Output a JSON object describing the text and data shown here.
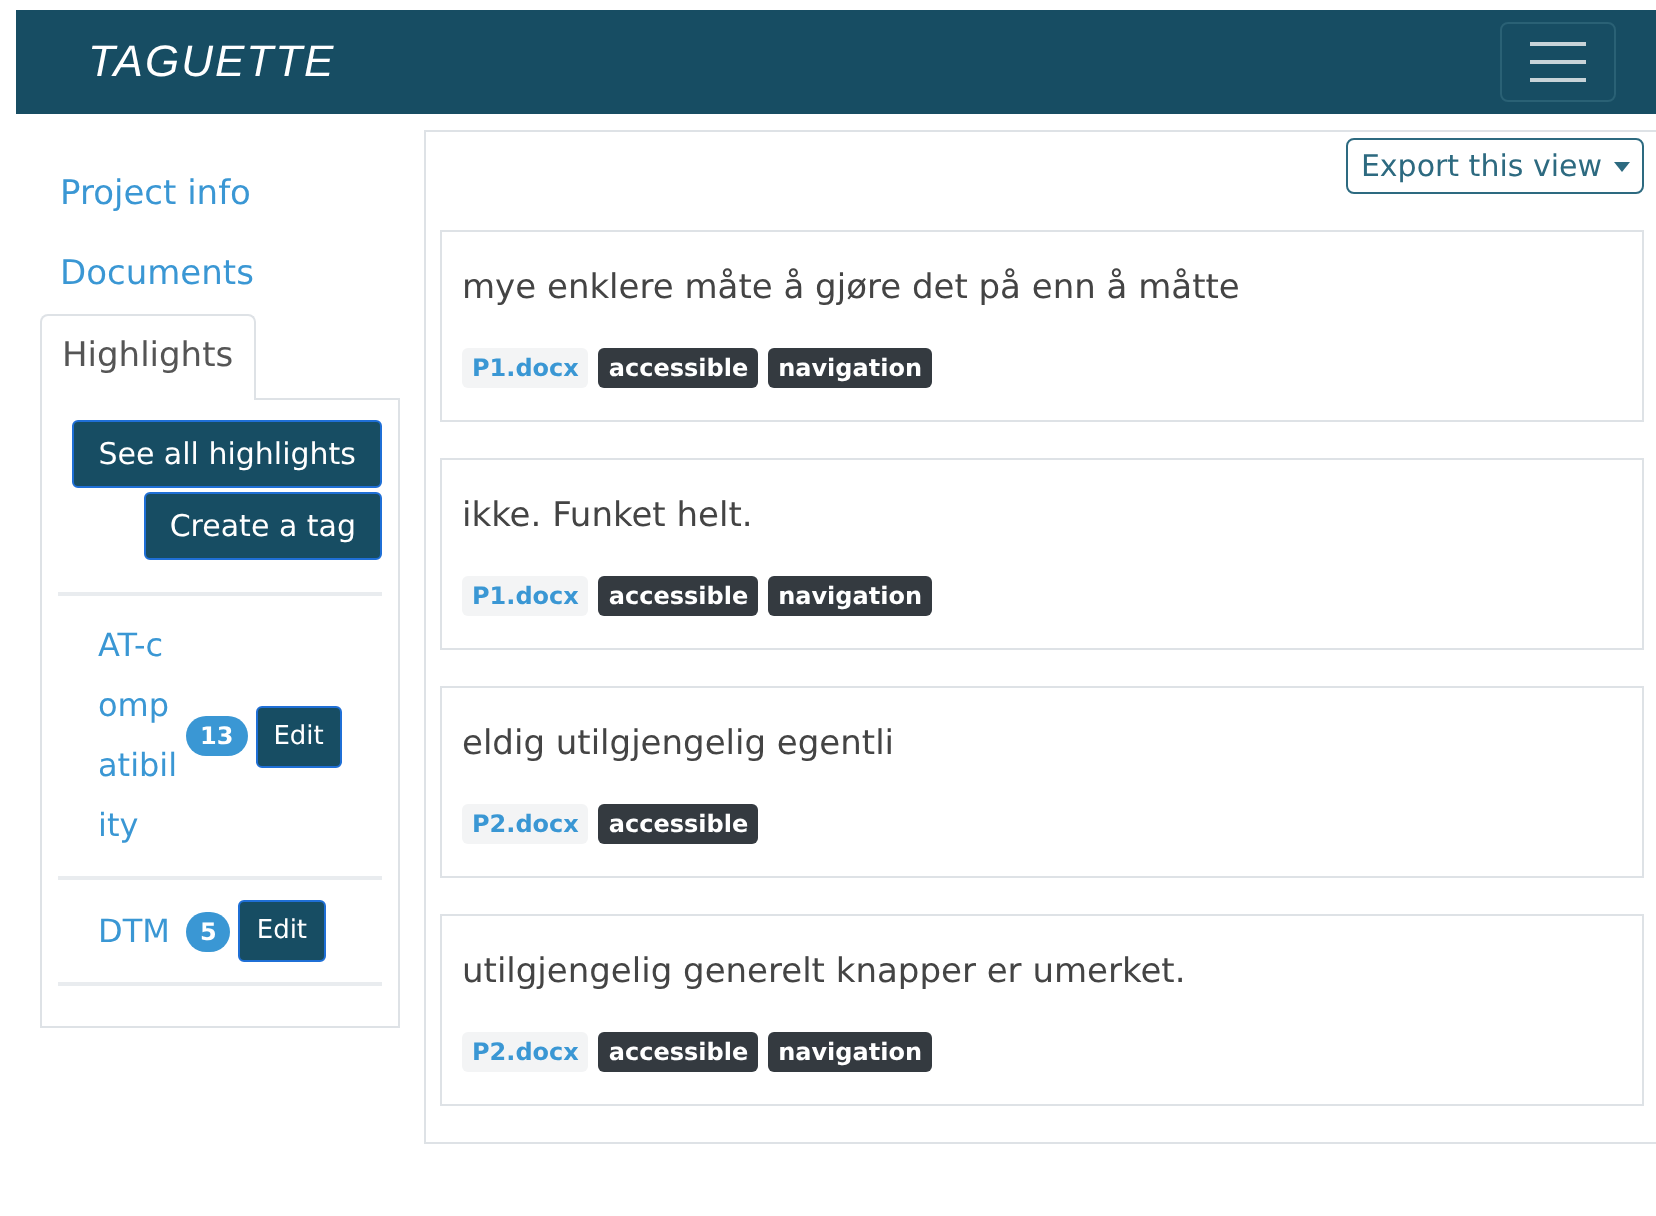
{
  "navbar": {
    "brand": "TAGUETTE"
  },
  "sidebar": {
    "links": [
      {
        "label": "Project info",
        "selected": false
      },
      {
        "label": "Documents",
        "selected": false
      },
      {
        "label": "Highlights",
        "selected": true
      }
    ],
    "buttons": [
      "See all highlights",
      "Create a tag"
    ],
    "tags": [
      {
        "name": "AT-compatibility",
        "count": "13",
        "action": "Edit"
      },
      {
        "name": "DTM",
        "count": "5",
        "action": "Edit"
      }
    ]
  },
  "main": {
    "export_button": "Export this view",
    "highlights": [
      {
        "text": "mye enklere måte å gjøre det på enn å måtte",
        "document": "P1.docx",
        "tags": [
          "accessible",
          "navigation"
        ]
      },
      {
        "text": "ikke. Funket helt.",
        "document": "P1.docx",
        "tags": [
          "accessible",
          "navigation"
        ]
      },
      {
        "text": "eldig utilgjengelig egentli",
        "document": "P2.docx",
        "tags": [
          "accessible"
        ]
      },
      {
        "text": "utilgjengelig generelt knapper er umerket.",
        "document": "P2.docx",
        "tags": [
          "accessible",
          "navigation"
        ]
      }
    ]
  }
}
